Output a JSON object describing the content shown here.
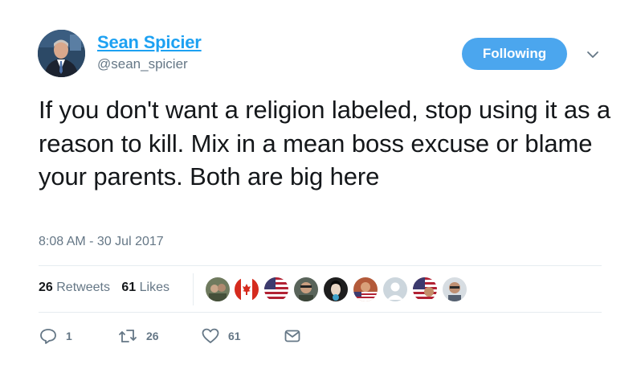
{
  "user": {
    "display_name": "Sean Spicier",
    "screen_name": "@sean_spicier",
    "avatar_icon": "profile-photo-icon"
  },
  "follow_button_label": "Following",
  "tweet": {
    "text": "If you don't want a religion labeled, stop using it as a reason to kill. Mix in a mean boss excuse or blame your parents. Both are big here",
    "timestamp": "8:08 AM - 30 Jul 2017"
  },
  "stats": {
    "retweets_count": "26",
    "retweets_label": "Retweets",
    "likes_count": "61",
    "likes_label": "Likes"
  },
  "liker_avatars": [
    "liker-avatar-photo",
    "liker-avatar-canada-flag",
    "liker-avatar-us-flag",
    "liker-avatar-photo",
    "liker-avatar-photo",
    "liker-avatar-us-flag",
    "liker-avatar-default",
    "liker-avatar-us-flag",
    "liker-avatar-photo"
  ],
  "actions": {
    "reply_count": "1",
    "retweet_count": "26",
    "like_count": "61"
  },
  "colors": {
    "accent": "#1da1f2",
    "button": "#4ba6ee",
    "muted": "#657786",
    "text": "#14171a",
    "divider": "#e6ecf0"
  }
}
